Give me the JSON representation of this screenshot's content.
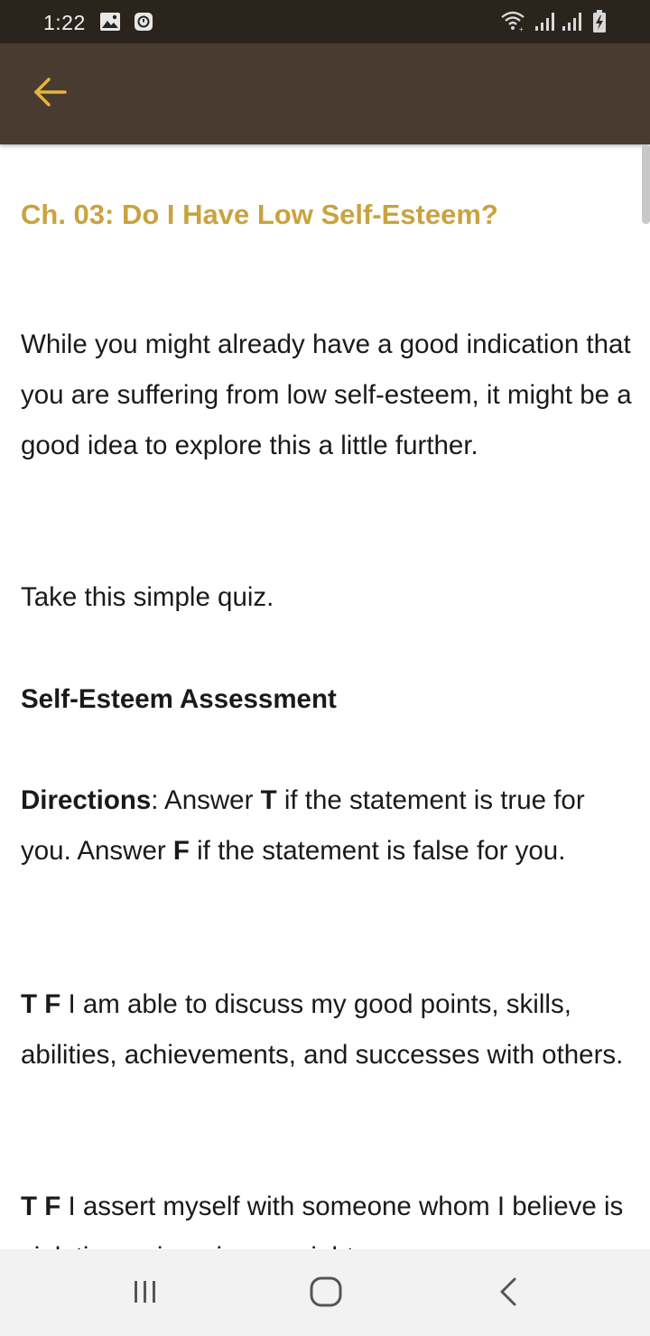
{
  "status_bar": {
    "time": "1:22",
    "icons": [
      "image-icon",
      "alarm-icon",
      "wifi-icon",
      "signal-icon",
      "signal-icon",
      "battery-charging-icon"
    ]
  },
  "app_bar": {
    "back_icon": "arrow-left-icon",
    "accent_color": "#e6b43c",
    "background_color": "#4a3b30"
  },
  "article": {
    "title": "Ch. 03: Do I Have Low Self-Esteem?",
    "title_color": "#c9a33e",
    "para1": "While you might already have a good indication that you are suffering from low self-esteem, it might be a good idea to explore this a little further.",
    "para2": "Take this simple quiz.",
    "heading": "Self-Esteem Assessment",
    "directions": {
      "label": "Directions",
      "text1": ": Answer ",
      "t": "T",
      "text2": " if the statement is true for you. Answer ",
      "f": "F",
      "text3": " if the statement is false for you."
    },
    "items": [
      {
        "tf": "T F",
        "text": " I am able to discuss my good points, skills, abilities, achievements, and successes with others."
      },
      {
        "tf": "T F",
        "text": " I assert myself with someone whom I believe is violating or ignoring my rights."
      }
    ]
  },
  "nav_bar": {
    "buttons": [
      "recent-apps-icon",
      "home-icon",
      "back-chevron-icon"
    ]
  }
}
